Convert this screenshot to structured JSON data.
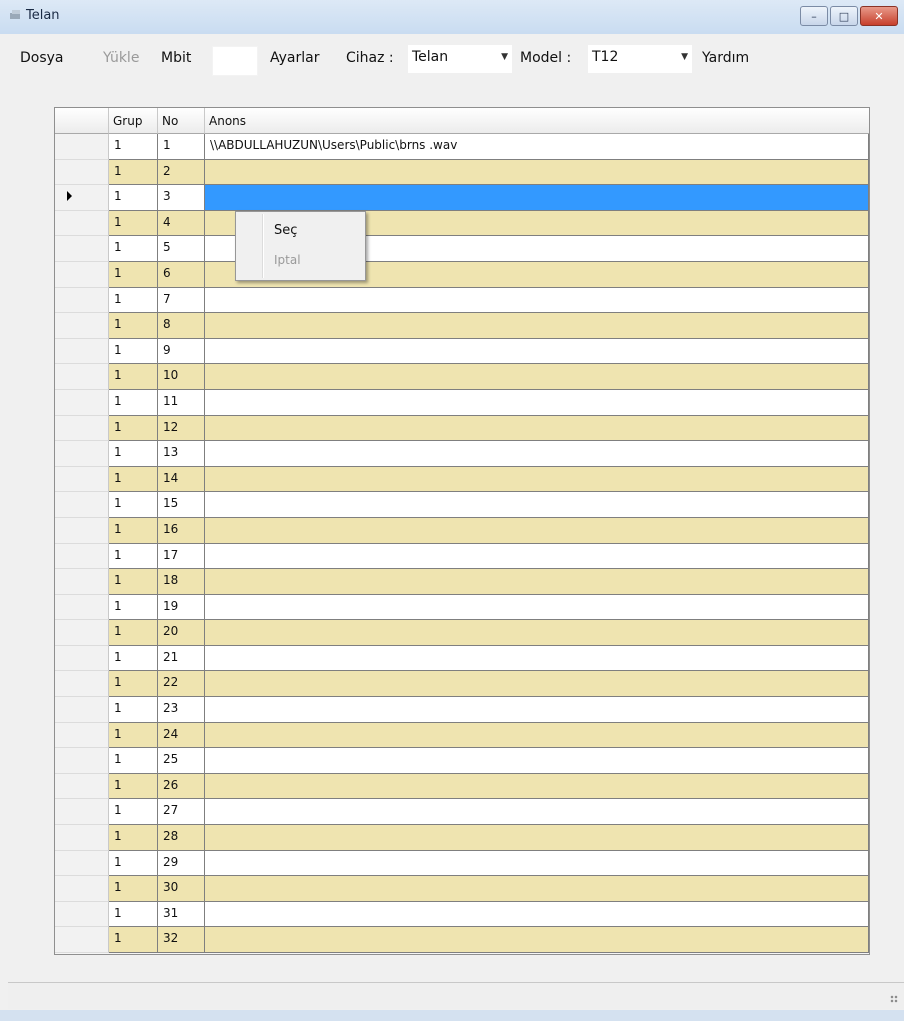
{
  "window": {
    "title": "Telan",
    "minimize": "–",
    "maximize": "□",
    "close": "✕"
  },
  "menu": {
    "dosya": "Dosya",
    "yukle": "Yükle",
    "mbit": "Mbit",
    "ayarlar": "Ayarlar",
    "cihaz_label": "Cihaz :",
    "cihaz_value": "Telan",
    "model_label": "Model :",
    "model_value": "T12",
    "yardim": "Yardım"
  },
  "grid": {
    "columns": [
      "Grup",
      "No",
      "Anons"
    ],
    "selected_row": 3,
    "rows": [
      {
        "grup": "1",
        "no": "1",
        "anons": "\\\\ABDULLAHUZUN\\Users\\Public\\brns .wav"
      },
      {
        "grup": "1",
        "no": "2",
        "anons": ""
      },
      {
        "grup": "1",
        "no": "3",
        "anons": ""
      },
      {
        "grup": "1",
        "no": "4",
        "anons": ""
      },
      {
        "grup": "1",
        "no": "5",
        "anons": ""
      },
      {
        "grup": "1",
        "no": "6",
        "anons": ""
      },
      {
        "grup": "1",
        "no": "7",
        "anons": ""
      },
      {
        "grup": "1",
        "no": "8",
        "anons": ""
      },
      {
        "grup": "1",
        "no": "9",
        "anons": ""
      },
      {
        "grup": "1",
        "no": "10",
        "anons": ""
      },
      {
        "grup": "1",
        "no": "11",
        "anons": ""
      },
      {
        "grup": "1",
        "no": "12",
        "anons": ""
      },
      {
        "grup": "1",
        "no": "13",
        "anons": ""
      },
      {
        "grup": "1",
        "no": "14",
        "anons": ""
      },
      {
        "grup": "1",
        "no": "15",
        "anons": ""
      },
      {
        "grup": "1",
        "no": "16",
        "anons": ""
      },
      {
        "grup": "1",
        "no": "17",
        "anons": ""
      },
      {
        "grup": "1",
        "no": "18",
        "anons": ""
      },
      {
        "grup": "1",
        "no": "19",
        "anons": ""
      },
      {
        "grup": "1",
        "no": "20",
        "anons": ""
      },
      {
        "grup": "1",
        "no": "21",
        "anons": ""
      },
      {
        "grup": "1",
        "no": "22",
        "anons": ""
      },
      {
        "grup": "1",
        "no": "23",
        "anons": ""
      },
      {
        "grup": "1",
        "no": "24",
        "anons": ""
      },
      {
        "grup": "1",
        "no": "25",
        "anons": ""
      },
      {
        "grup": "1",
        "no": "26",
        "anons": ""
      },
      {
        "grup": "1",
        "no": "27",
        "anons": ""
      },
      {
        "grup": "1",
        "no": "28",
        "anons": ""
      },
      {
        "grup": "1",
        "no": "29",
        "anons": ""
      },
      {
        "grup": "1",
        "no": "30",
        "anons": ""
      },
      {
        "grup": "1",
        "no": "31",
        "anons": ""
      },
      {
        "grup": "1",
        "no": "32",
        "anons": ""
      }
    ]
  },
  "context_menu": {
    "items": [
      {
        "label": "Seç",
        "enabled": true
      },
      {
        "label": "Iptal",
        "enabled": false
      }
    ]
  },
  "colors": {
    "alt_row": "#efe4b0",
    "selection": "#3399ff"
  }
}
